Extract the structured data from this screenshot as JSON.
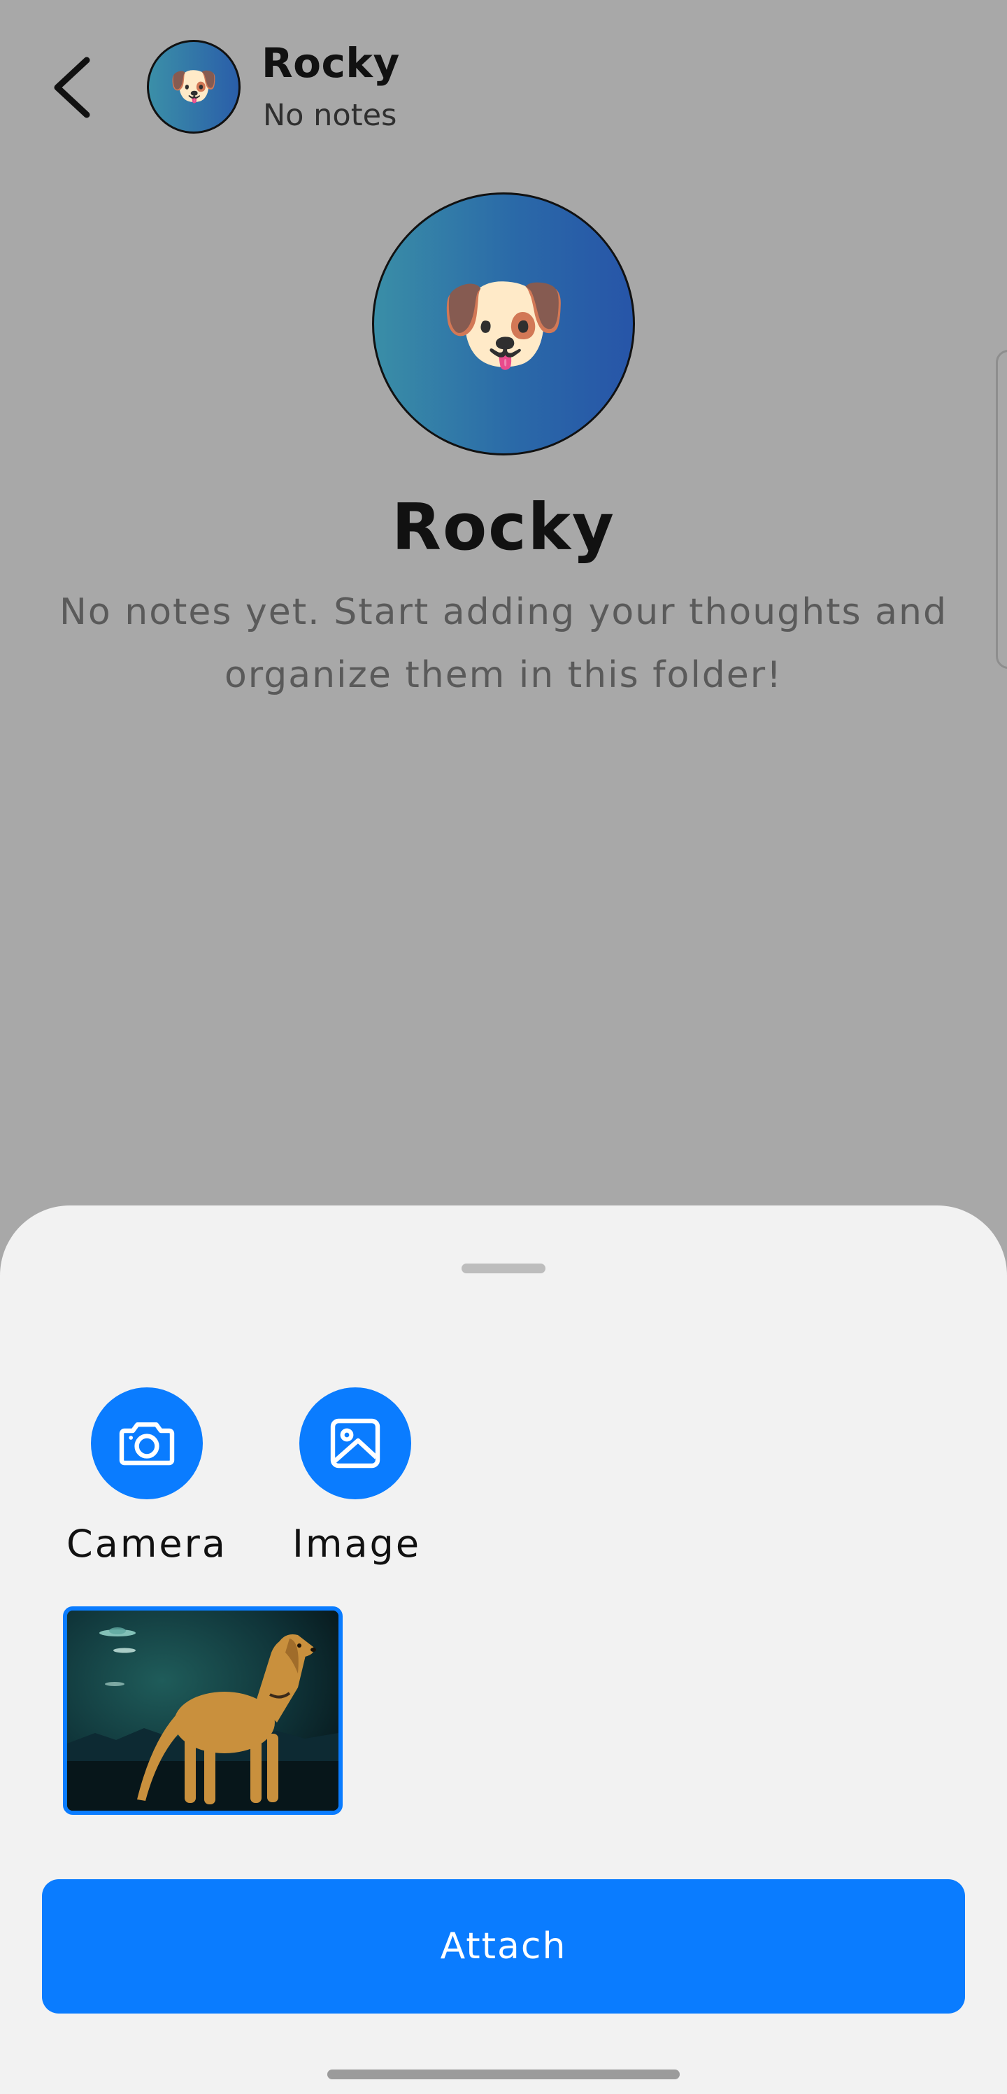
{
  "header": {
    "title": "Rocky",
    "subtitle": "No notes",
    "avatar_emoji": "🐶"
  },
  "folder": {
    "avatar_emoji": "🐶",
    "title": "Rocky",
    "empty_line1": "No notes yet. Start adding your thoughts and",
    "empty_line2": "organize them in this folder!"
  },
  "sheet": {
    "options": [
      {
        "label": "Camera",
        "icon": "camera-icon"
      },
      {
        "label": "Image",
        "icon": "image-icon"
      }
    ],
    "attach_label": "Attach"
  },
  "colors": {
    "accent": "#0a7cff",
    "overlay": "#a8a8a8",
    "sheet": "#f2f2f2"
  }
}
